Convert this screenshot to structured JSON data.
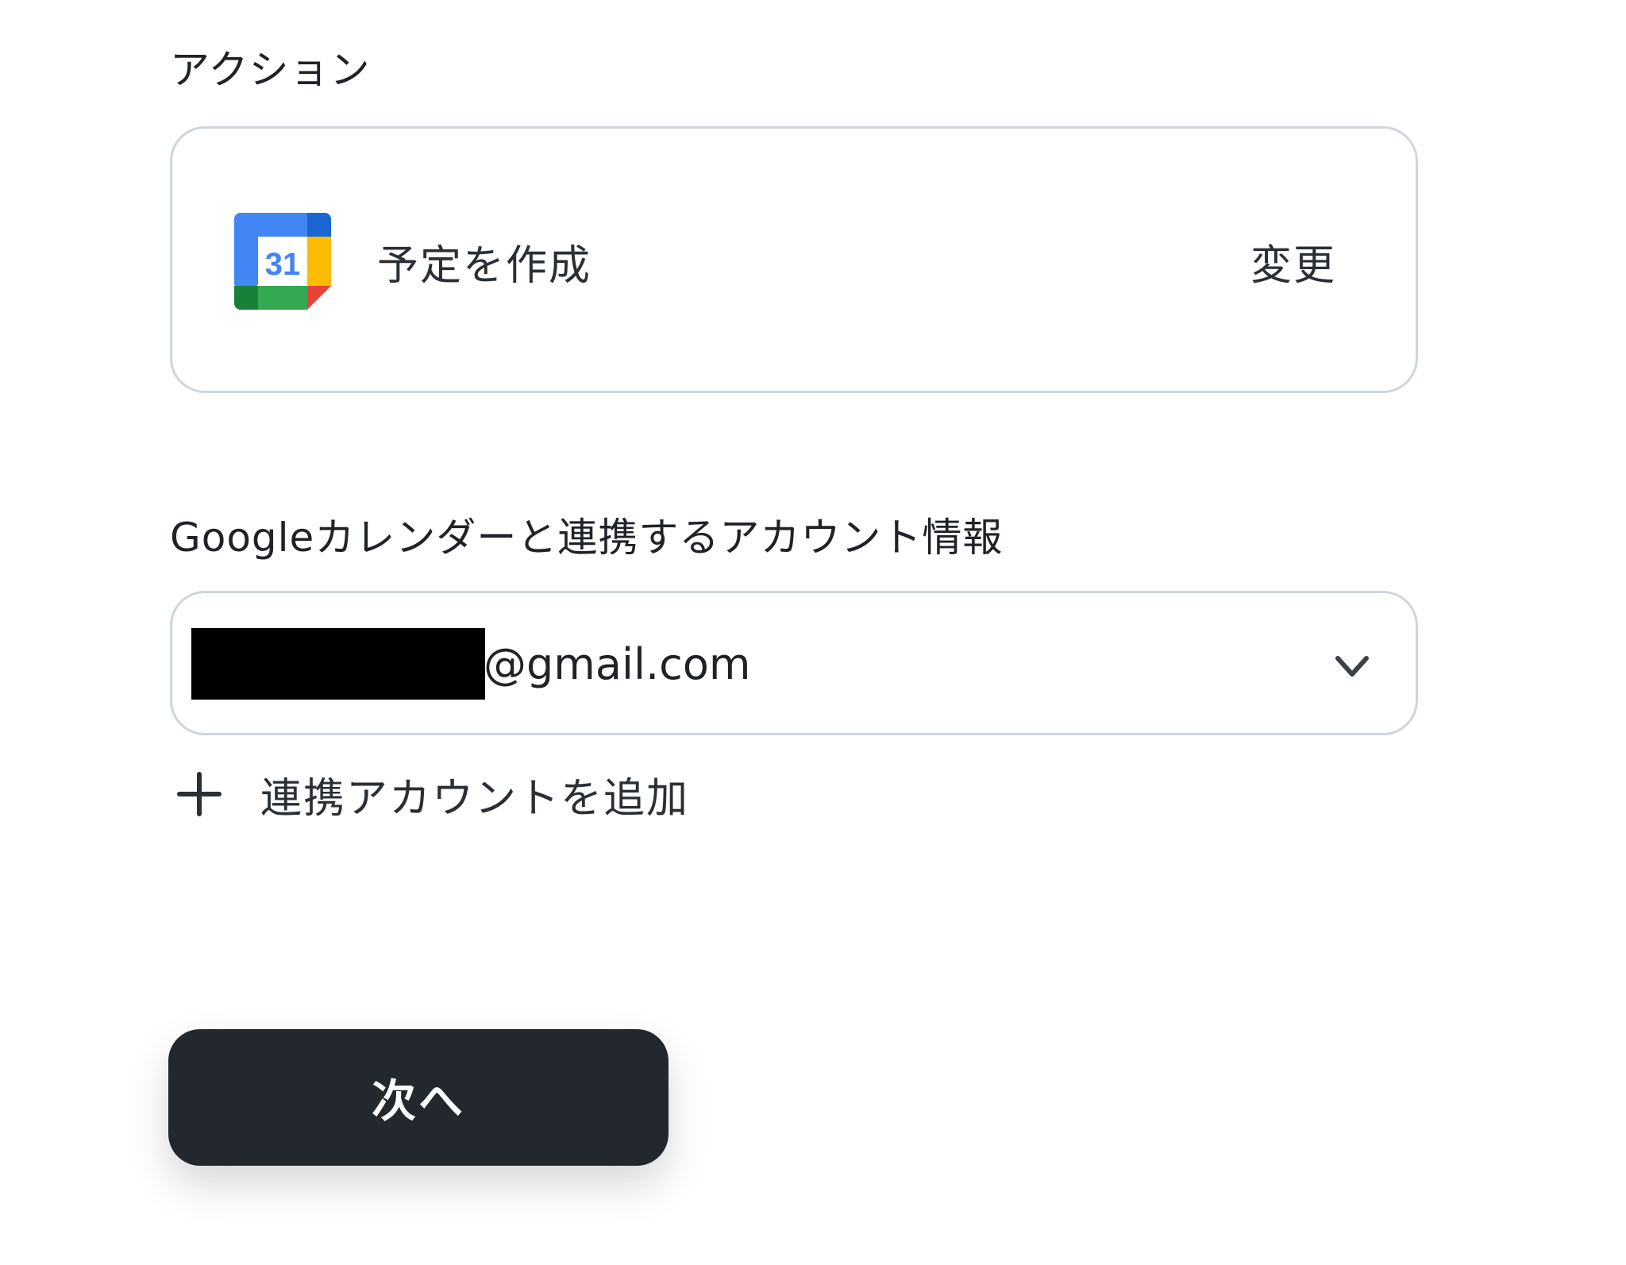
{
  "action_section": {
    "label": "アクション",
    "card": {
      "icon": "google-calendar-icon",
      "icon_day": "31",
      "action_name": "予定を作成",
      "change_label": "変更"
    }
  },
  "account_section": {
    "label": "Googleカレンダーと連携するアカウント情報",
    "selected_account_domain": "@gmail.com",
    "add_account_label": "連携アカウントを追加"
  },
  "footer": {
    "next_label": "次へ"
  },
  "colors": {
    "button_bg": "#23272e",
    "border": "#cfd5dc",
    "text": "#1f2328"
  }
}
